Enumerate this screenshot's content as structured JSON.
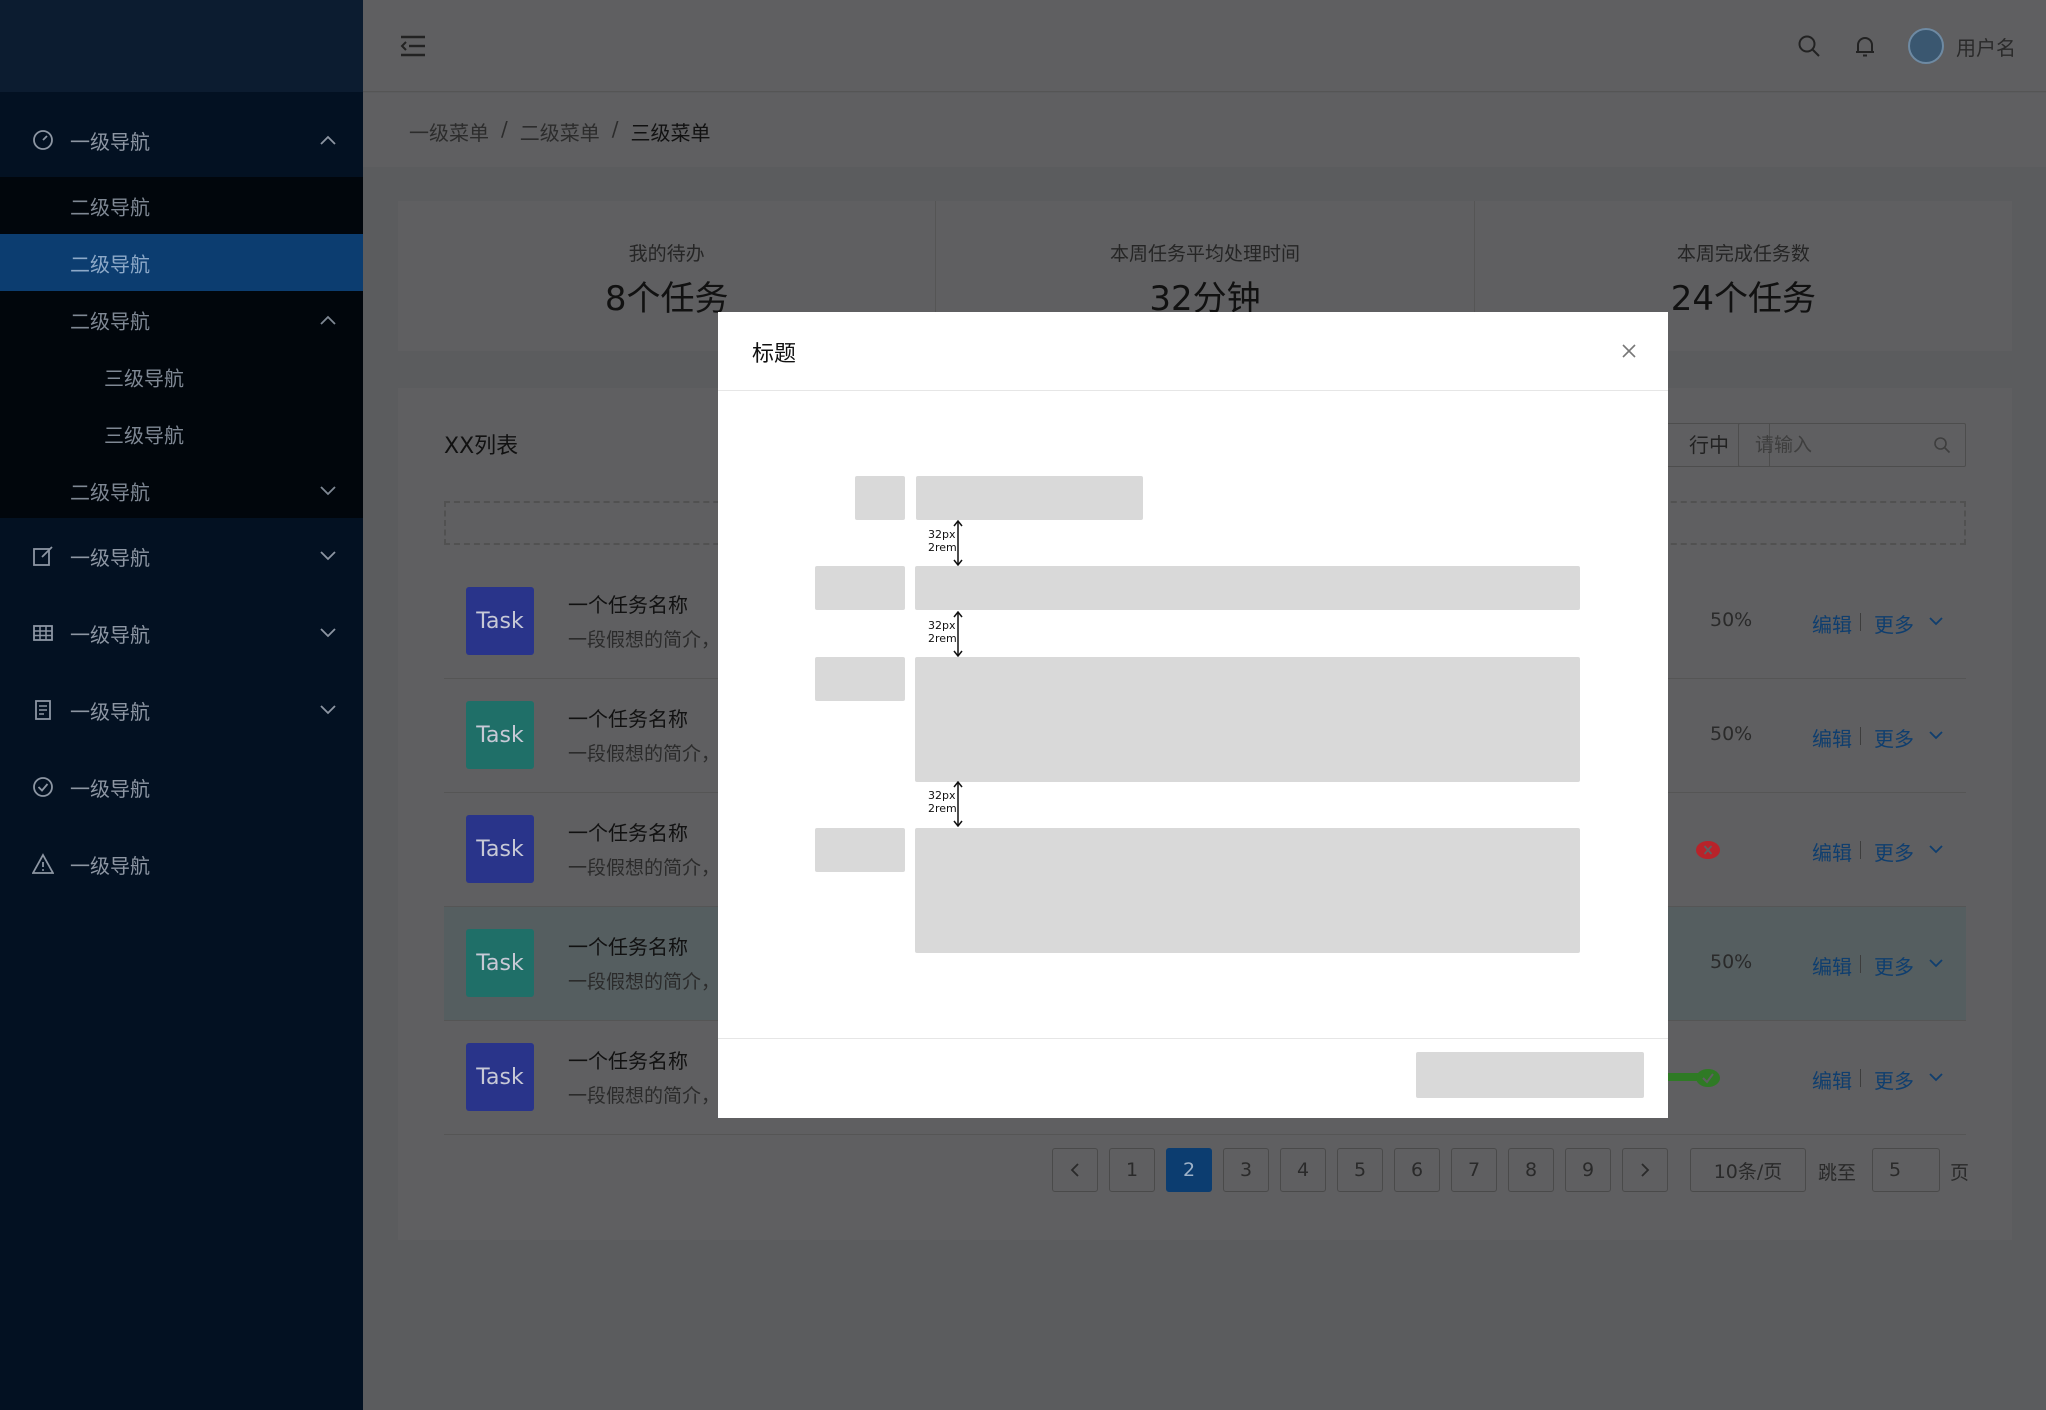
{
  "sidebar": {
    "items": [
      {
        "label": "一级导航",
        "icon": "dashboard-icon",
        "expanded": true
      },
      {
        "label": "一级导航",
        "icon": "edit-icon",
        "expanded": false
      },
      {
        "label": "一级导航",
        "icon": "table-icon",
        "expanded": false
      },
      {
        "label": "一级导航",
        "icon": "document-icon",
        "expanded": false
      },
      {
        "label": "一级导航",
        "icon": "check-circle-icon"
      },
      {
        "label": "一级导航",
        "icon": "warning-icon"
      }
    ],
    "sub_items": [
      {
        "label": "二级导航"
      },
      {
        "label": "二级导航",
        "active": true
      },
      {
        "label": "二级导航",
        "expanded": true
      },
      {
        "label": "三级导航"
      },
      {
        "label": "三级导航"
      },
      {
        "label": "二级导航",
        "expanded": false
      }
    ]
  },
  "header": {
    "username": "用户名"
  },
  "breadcrumb": {
    "items": [
      "一级菜单",
      "二级菜单",
      "三级菜单"
    ],
    "separator": "/"
  },
  "stats": [
    {
      "title": "我的待办",
      "value": "8个任务"
    },
    {
      "title": "本周任务平均处理时间",
      "value": "32分钟"
    },
    {
      "title": "本周完成任务数",
      "value": "24个任务"
    }
  ],
  "list": {
    "title": "XX列表",
    "filter_label": "行中",
    "search_placeholder": "请输入",
    "rows": [
      {
        "badge": "Task",
        "badge_color": "#29348a",
        "name": "一个任务名称",
        "desc": "一段假想的简介，",
        "progress": "50%",
        "edit": "编辑",
        "more": "更多"
      },
      {
        "badge": "Task",
        "badge_color": "#1f6f68",
        "name": "一个任务名称",
        "desc": "一段假想的简介，",
        "progress": "50%",
        "edit": "编辑",
        "more": "更多"
      },
      {
        "badge": "Task",
        "badge_color": "#29348a",
        "name": "一个任务名称",
        "desc": "一段假想的简介，",
        "status": "error",
        "edit": "编辑",
        "more": "更多"
      },
      {
        "badge": "Task",
        "badge_color": "#1f6f68",
        "name": "一个任务名称",
        "desc": "一段假想的简介，",
        "progress": "50%",
        "edit": "编辑",
        "more": "更多",
        "highlighted": true
      },
      {
        "badge": "Task",
        "badge_color": "#29348a",
        "name": "一个任务名称",
        "desc": "一段假想的简介，",
        "status": "success",
        "edit": "编辑",
        "more": "更多"
      }
    ]
  },
  "pagination": {
    "pages": [
      "1",
      "2",
      "3",
      "4",
      "5",
      "6",
      "7",
      "8",
      "9"
    ],
    "current": "2",
    "page_size": "10条/页",
    "jump_label": "跳至",
    "jump_value": "5",
    "page_suffix": "页"
  },
  "modal": {
    "title": "标题",
    "spacing_label_1": "32px",
    "spacing_label_2": "2rem"
  },
  "colors": {
    "sidebar_bg": "#031122",
    "active_nav": "#0c3d70",
    "link": "#0f3e6e",
    "placeholder_gray": "#d9d9d9",
    "error": "#b8232a",
    "success": "#2f7a25"
  }
}
